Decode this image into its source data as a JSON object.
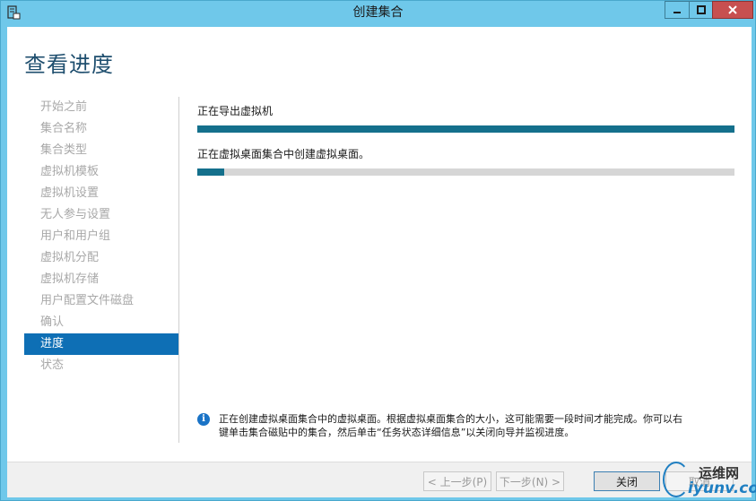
{
  "window": {
    "title": "创建集合"
  },
  "page": {
    "title": "查看进度"
  },
  "nav": {
    "items": [
      {
        "label": "开始之前",
        "active": false
      },
      {
        "label": "集合名称",
        "active": false
      },
      {
        "label": "集合类型",
        "active": false
      },
      {
        "label": "虚拟机模板",
        "active": false
      },
      {
        "label": "虚拟机设置",
        "active": false
      },
      {
        "label": "无人参与设置",
        "active": false
      },
      {
        "label": "用户和用户组",
        "active": false
      },
      {
        "label": "虚拟机分配",
        "active": false
      },
      {
        "label": "虚拟机存储",
        "active": false
      },
      {
        "label": "用户配置文件磁盘",
        "active": false
      },
      {
        "label": "确认",
        "active": false
      },
      {
        "label": "进度",
        "active": true
      },
      {
        "label": "状态",
        "active": false
      }
    ]
  },
  "tasks": [
    {
      "label": "正在导出虚拟机",
      "progress": 1.0
    },
    {
      "label": "正在虚拟桌面集合中创建虚拟桌面。",
      "progress": 0.05
    }
  ],
  "info": {
    "line1": "正在创建虚拟桌面集合中的虚拟桌面。根据虚拟桌面集合的大小，这可能需要一段时间才能完成。你可以右",
    "line2": "键单击集合磁贴中的集合，然后单击“任务状态详细信息”以关闭向导并监视进度。"
  },
  "buttons": {
    "prev": "< 上一步(P)",
    "next": "下一步(N) >",
    "close": "关闭",
    "cancel": "取消"
  },
  "watermark": {
    "top": "运维网",
    "bottom": "iyunv.com"
  },
  "colors": {
    "titlebar": "#6fc8ea",
    "accent": "#0e6fb5",
    "progress": "#14708c",
    "close_button": "#c75050"
  }
}
